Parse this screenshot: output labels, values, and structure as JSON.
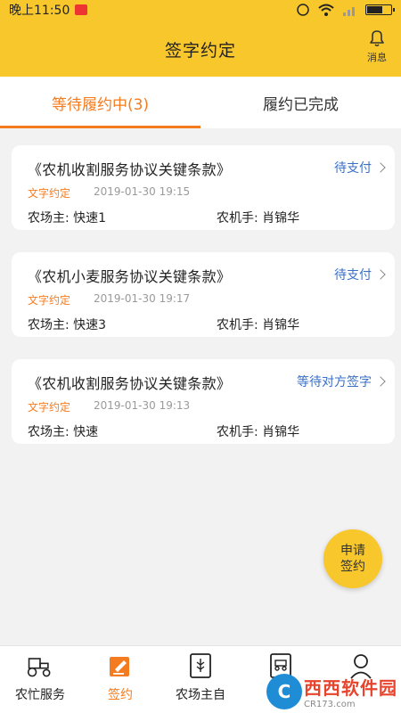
{
  "status_bar": {
    "time": "晚上11:50"
  },
  "header": {
    "title": "签字约定",
    "message_label": "消息"
  },
  "tabs": [
    {
      "label": "等待履约中(3)",
      "active": true
    },
    {
      "label": "履约已完成",
      "active": false
    }
  ],
  "cards": [
    {
      "title": "《农机收割服务协议关键条款》",
      "status": "待支付",
      "tag": "文字约定",
      "date": "2019-01-30 19:15",
      "farmer": "农场主: 快速1",
      "operator": "农机手: 肖锦华"
    },
    {
      "title": "《农机小麦服务协议关键条款》",
      "status": "待支付",
      "tag": "文字约定",
      "date": "2019-01-30 19:17",
      "farmer": "农场主: 快速3",
      "operator": "农机手: 肖锦华"
    },
    {
      "title": "《农机收割服务协议关键条款》",
      "status": "等待对方签字",
      "tag": "文字约定",
      "date": "2019-01-30 19:13",
      "farmer": "农场主: 快速",
      "operator": "农机手: 肖锦华"
    }
  ],
  "fab": {
    "line1": "申请",
    "line2": "签约"
  },
  "bottom_nav": [
    {
      "label": "农忙服务",
      "icon": "tractor-icon"
    },
    {
      "label": "签约",
      "icon": "sign-icon",
      "active": true
    },
    {
      "label": "农场主自",
      "icon": "document-icon"
    },
    {
      "label": "",
      "icon": "machine-card-icon"
    },
    {
      "label": "",
      "icon": "user-icon"
    }
  ],
  "watermark": {
    "logo": "C",
    "text": "西西软件园",
    "sub": "CR173.com"
  },
  "colors": {
    "accent": "#f47b20",
    "header": "#f8c72b",
    "status_link": "#3a70c6"
  },
  "battery_level": 0.6
}
